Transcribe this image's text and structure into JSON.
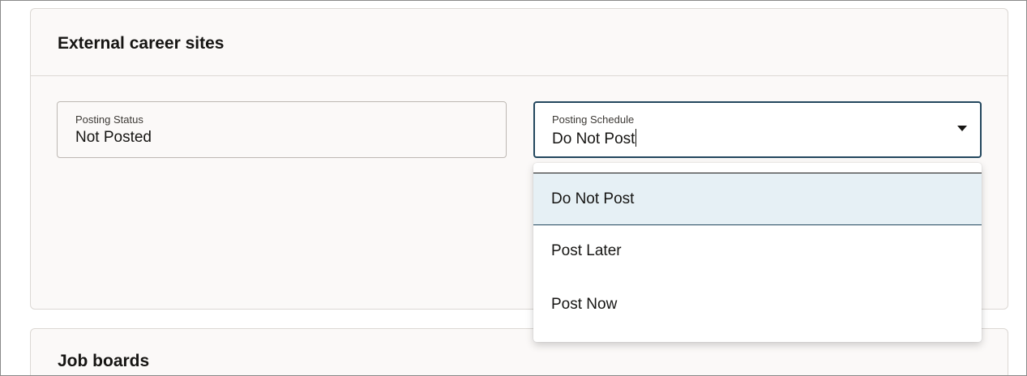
{
  "external_section": {
    "title": "External career sites",
    "posting_status": {
      "label": "Posting Status",
      "value": "Not Posted"
    },
    "posting_schedule": {
      "label": "Posting Schedule",
      "value": "Do Not Post",
      "options": [
        "Do Not Post",
        "Post Later",
        "Post Now"
      ],
      "selected_index": 0
    }
  },
  "job_boards_section": {
    "title": "Job boards"
  },
  "icons": {
    "dropdown": "chevron-down-icon"
  },
  "colors": {
    "focus_border": "#23475e",
    "selected_option_bg": "#e6f0f5",
    "card_bg": "#fbf9f8"
  }
}
